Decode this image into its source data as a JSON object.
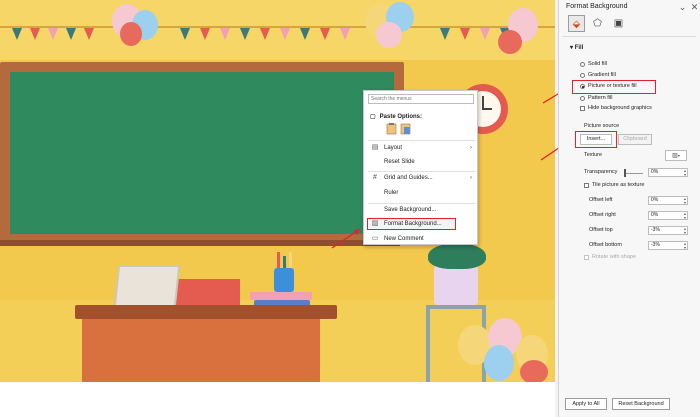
{
  "context_menu": {
    "search_placeholder": "Search the menus",
    "paste_options_label": "Paste Options:",
    "items": [
      {
        "icon": "layout-icon",
        "label": "Layout",
        "has_submenu": true
      },
      {
        "icon": "",
        "label": "Reset Slide",
        "has_submenu": false
      },
      {
        "icon": "grid-icon",
        "label": "Grid and Guides...",
        "has_submenu": true
      },
      {
        "icon": "",
        "label": "Ruler",
        "has_submenu": false
      },
      {
        "icon": "",
        "label": "Save Background...",
        "has_submenu": false
      },
      {
        "icon": "format-background-icon",
        "label": "Format Background...",
        "has_submenu": false
      },
      {
        "icon": "comment-icon",
        "label": "New Comment",
        "has_submenu": false
      }
    ]
  },
  "pane": {
    "title": "Format Background",
    "section_fill": "Fill",
    "fill_options": [
      "Solid fill",
      "Gradient fill",
      "Picture or texture fill",
      "Pattern fill"
    ],
    "selected_fill": "Picture or texture fill",
    "hide_bg_graphics": "Hide background graphics",
    "picture_source": "Picture source",
    "insert_label": "Insert...",
    "clipboard_label": "Clipboard",
    "texture_label": "Texture",
    "transparency_label": "Transparency",
    "transparency_value": "0%",
    "tile_label": "Tile picture as texture",
    "offsets": [
      {
        "label": "Offset left",
        "value": "0%"
      },
      {
        "label": "Offset right",
        "value": "0%"
      },
      {
        "label": "Offset top",
        "value": "-3%"
      },
      {
        "label": "Offset bottom",
        "value": "-3%"
      }
    ],
    "rotate_label": "Rotate with shape",
    "apply_all": "Apply to All",
    "reset_bg": "Reset Background"
  },
  "colors": {
    "accent_red": "#e0222c",
    "board_green": "#2f8a5e"
  }
}
